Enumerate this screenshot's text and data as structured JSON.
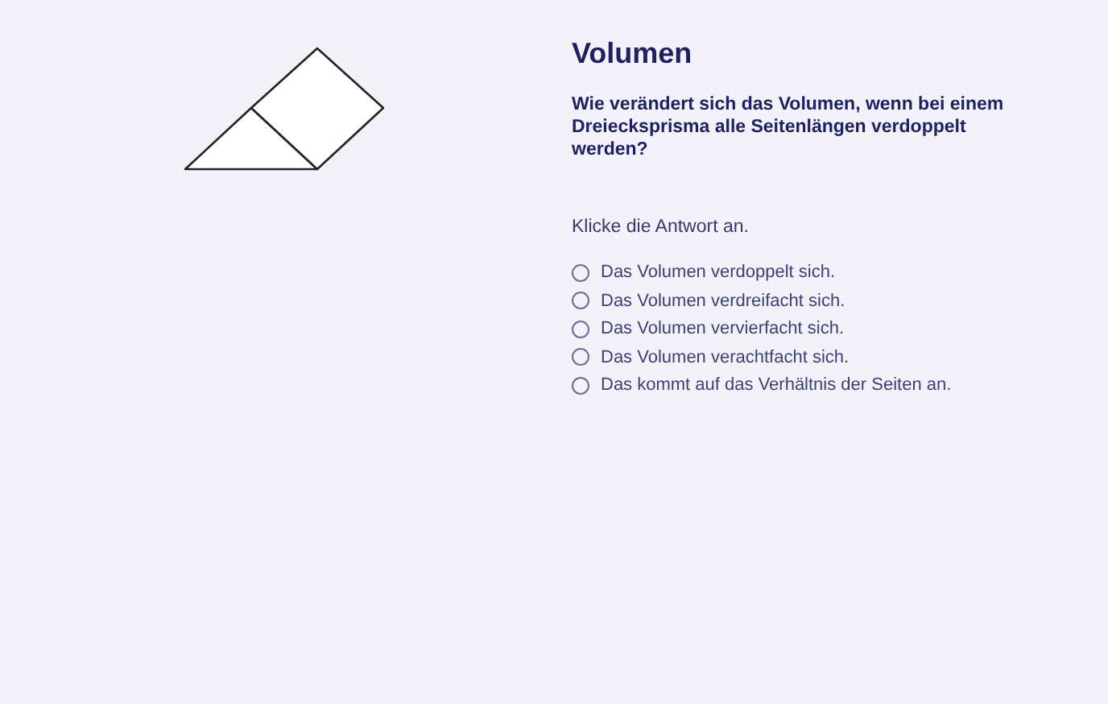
{
  "title": "Volumen",
  "question": "Wie verändert sich das Volumen, wenn bei einem Dreiecksprisma alle Seitenlängen verdoppelt werden?",
  "instruction": "Klicke die Antwort an.",
  "options": [
    {
      "label": "Das Volumen verdoppelt sich.",
      "selected": false
    },
    {
      "label": "Das Volumen verdreifacht sich.",
      "selected": false
    },
    {
      "label": "Das Volumen vervierfacht sich.",
      "selected": false
    },
    {
      "label": "Das Volumen verachtfacht sich.",
      "selected": false
    },
    {
      "label": "Das kommt auf das Verhältnis der Seiten an.",
      "selected": false
    }
  ]
}
